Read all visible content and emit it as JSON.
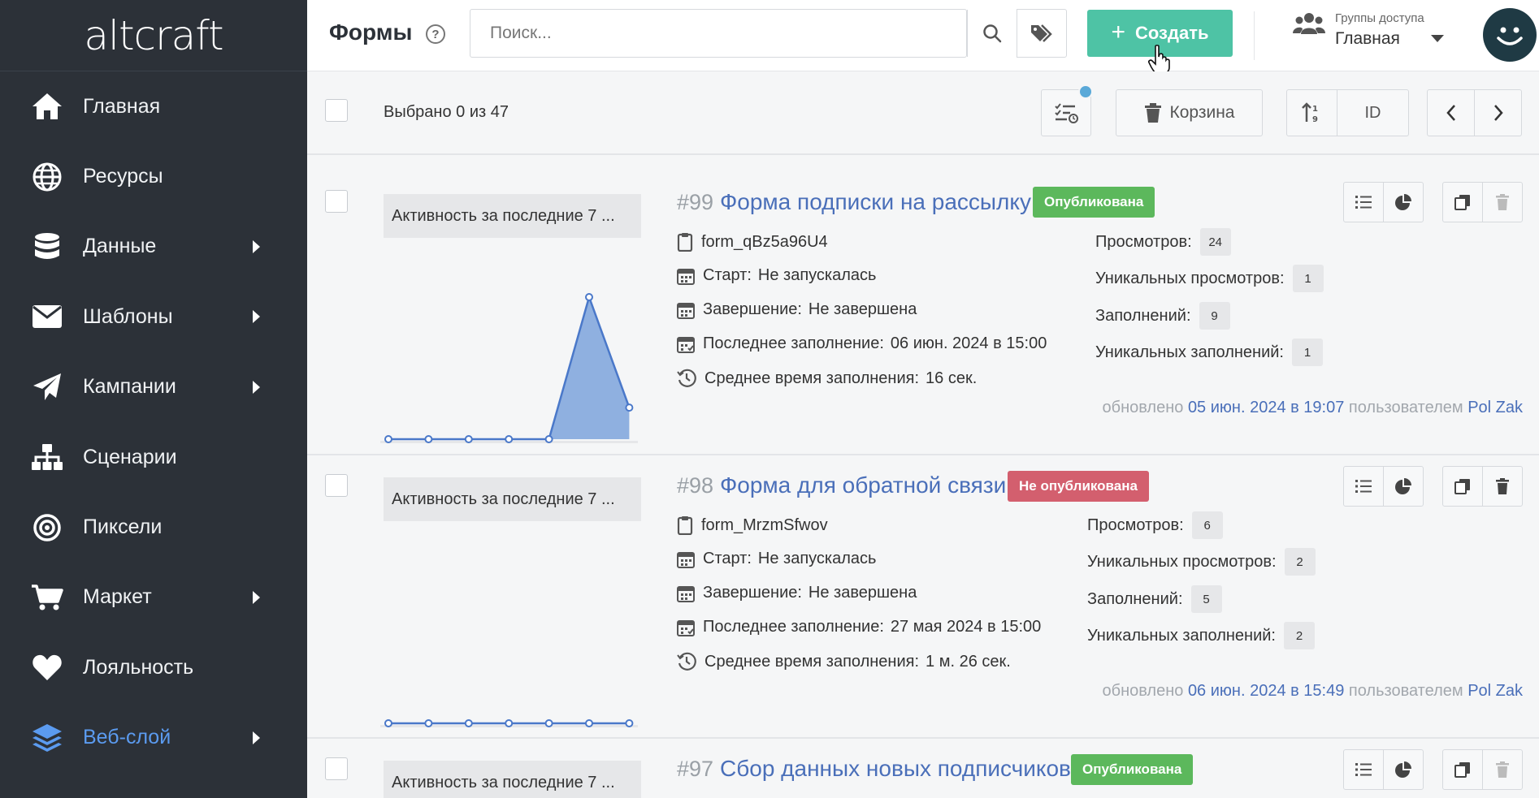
{
  "logo": "altcraft",
  "sidebar": {
    "items": [
      {
        "label": "Главная",
        "icon": "home-icon",
        "submenu": false,
        "active": false
      },
      {
        "label": "Ресурсы",
        "icon": "globe-icon",
        "submenu": false,
        "active": false
      },
      {
        "label": "Данные",
        "icon": "database-icon",
        "submenu": true,
        "active": false
      },
      {
        "label": "Шаблоны",
        "icon": "envelope-icon",
        "submenu": true,
        "active": false
      },
      {
        "label": "Кампании",
        "icon": "paper-plane-icon",
        "submenu": true,
        "active": false
      },
      {
        "label": "Сценарии",
        "icon": "sitemap-icon",
        "submenu": false,
        "active": false
      },
      {
        "label": "Пиксели",
        "icon": "target-icon",
        "submenu": false,
        "active": false
      },
      {
        "label": "Маркет",
        "icon": "cart-icon",
        "submenu": true,
        "active": false
      },
      {
        "label": "Лояльность",
        "icon": "heart-icon",
        "submenu": false,
        "active": false
      },
      {
        "label": "Веб-слой",
        "icon": "layers-icon",
        "submenu": true,
        "active": true
      }
    ]
  },
  "header": {
    "title": "Формы",
    "search_placeholder": "Поиск...",
    "create_label": "Создать",
    "access_group_label": "Группы доступа",
    "access_group_value": "Главная"
  },
  "toolbar": {
    "selected_text": "Выбрано 0 из 47",
    "trash_label": "Корзина",
    "sort_field": "ID"
  },
  "colors": {
    "sidebar_bg": "#2c3138",
    "accent_green": "#4ec3a5",
    "link_blue": "#4a6fb9",
    "published": "#5cb85c",
    "unpublished": "#d35f6e",
    "active_nav": "#5b9bf0"
  },
  "forms": [
    {
      "id": "#99",
      "title": "Форма подписки на рассылку",
      "status": "Опубликована",
      "published": true,
      "chart_label": "Активность за последние 7 ...",
      "code": "form_qBz5a96U4",
      "start_label": "Старт:",
      "start_value": "Не запускалась",
      "end_label": "Завершение:",
      "end_value": "Не завершена",
      "last_fill_label": "Последнее заполнение:",
      "last_fill_value": "06 июн. 2024 в 15:00",
      "avg_time_label": "Среднее время заполнения:",
      "avg_time_value": "16 сек.",
      "views_label": "Просмотров:",
      "views": "24",
      "unique_views_label": "Уникальных просмотров:",
      "unique_views": "1",
      "fills_label": "Заполнений:",
      "fills": "9",
      "unique_fills_label": "Уникальных заполнений:",
      "unique_fills": "1",
      "updated_prefix": "обновлено",
      "updated_date": "05 июн. 2024 в 19:07",
      "updated_by_prefix": "пользователем",
      "updated_by": "Pol Zak",
      "activity": [
        0,
        0,
        0,
        0,
        0,
        9,
        2
      ]
    },
    {
      "id": "#98",
      "title": "Форма для обратной связи",
      "status": "Не опубликована",
      "published": false,
      "chart_label": "Активность за последние 7 ...",
      "code": "form_MrzmSfwov",
      "start_label": "Старт:",
      "start_value": "Не запускалась",
      "end_label": "Завершение:",
      "end_value": "Не завершена",
      "last_fill_label": "Последнее заполнение:",
      "last_fill_value": "27 мая 2024 в 15:00",
      "avg_time_label": "Среднее время заполнения:",
      "avg_time_value": "1 м. 26 сек.",
      "views_label": "Просмотров:",
      "views": "6",
      "unique_views_label": "Уникальных просмотров:",
      "unique_views": "2",
      "fills_label": "Заполнений:",
      "fills": "5",
      "unique_fills_label": "Уникальных заполнений:",
      "unique_fills": "2",
      "updated_prefix": "обновлено",
      "updated_date": "06 июн. 2024 в 15:49",
      "updated_by_prefix": "пользователем",
      "updated_by": "Pol Zak",
      "activity": [
        0,
        0,
        0,
        0,
        0,
        0,
        0
      ]
    },
    {
      "id": "#97",
      "title": "Сбор данных новых подписчиков",
      "status": "Опубликована",
      "published": true,
      "chart_label": "Активность за последние 7 ..."
    }
  ]
}
